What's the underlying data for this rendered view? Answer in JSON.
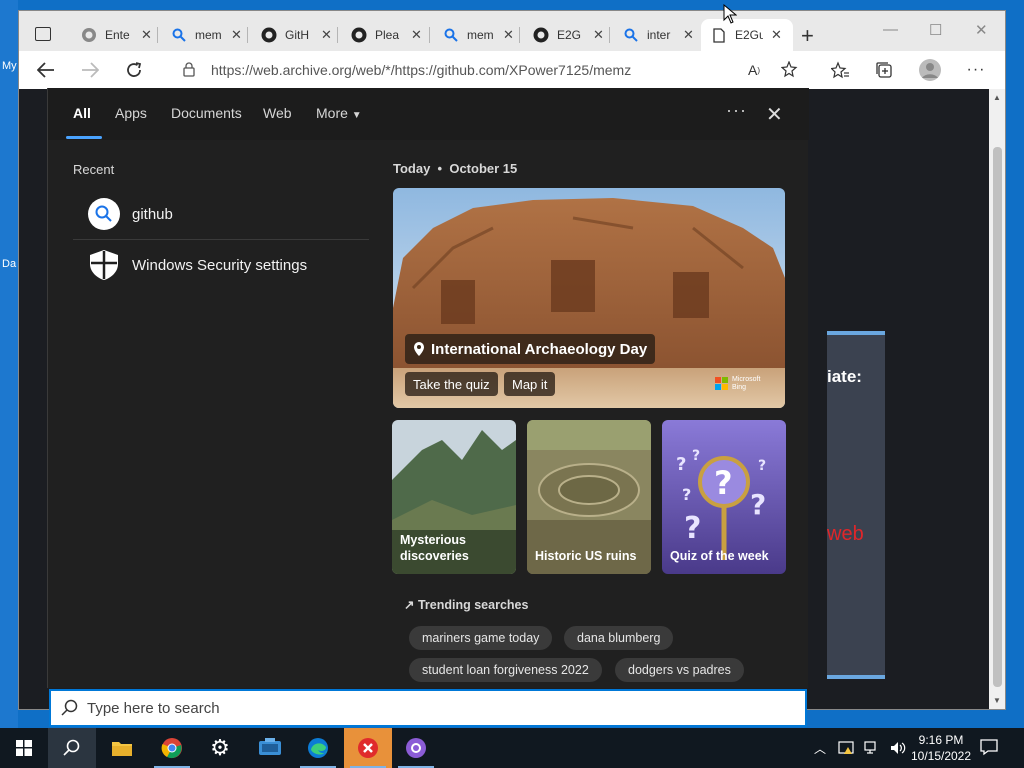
{
  "desktop": {
    "fragments": [
      "My",
      "Da"
    ]
  },
  "browser": {
    "tabs": [
      {
        "title": "Ente",
        "icon": "github-icon"
      },
      {
        "title": "mem",
        "icon": "search-icon"
      },
      {
        "title": "GitH",
        "icon": "github-icon"
      },
      {
        "title": "Plea",
        "icon": "github-icon"
      },
      {
        "title": "mem",
        "icon": "search-icon"
      },
      {
        "title": "E2G",
        "icon": "github-icon"
      },
      {
        "title": "inter",
        "icon": "search-icon"
      },
      {
        "title": "E2Gu",
        "icon": "page-icon",
        "active": true
      }
    ],
    "address": "https://web.archive.org/web/*/https://github.com/XPower7125/memz",
    "page_fragments": {
      "word1": "iate:",
      "word2": "web"
    }
  },
  "search": {
    "filters": [
      "All",
      "Apps",
      "Documents",
      "Web",
      "More"
    ],
    "recent_label": "Recent",
    "recent": [
      {
        "text": "github",
        "icon": "search-icon"
      },
      {
        "text": "Windows Security settings",
        "icon": "shield-icon"
      }
    ],
    "today_label": "Today",
    "today_date": "October 15",
    "hero": {
      "title": "International Archaeology Day",
      "buttons": [
        "Take the quiz",
        "Map it"
      ],
      "brand": "Microsoft Bing"
    },
    "tiles": [
      {
        "label_line1": "Mysterious",
        "label_line2": "discoveries"
      },
      {
        "label_line1": "Historic US ruins",
        "label_line2": ""
      },
      {
        "label_line1": "Quiz of the week",
        "label_line2": ""
      }
    ],
    "trending_label": "Trending searches",
    "trending": [
      "mariners game today",
      "dana blumberg",
      "student loan forgiveness 2022",
      "dodgers vs padres"
    ],
    "box_placeholder": "Type here to search"
  },
  "taskbar": {
    "time": "9:16 PM",
    "date": "10/15/2022"
  },
  "colors": {
    "accent": "#0078d7",
    "taskbar": "#101820",
    "panel": "#202020"
  }
}
